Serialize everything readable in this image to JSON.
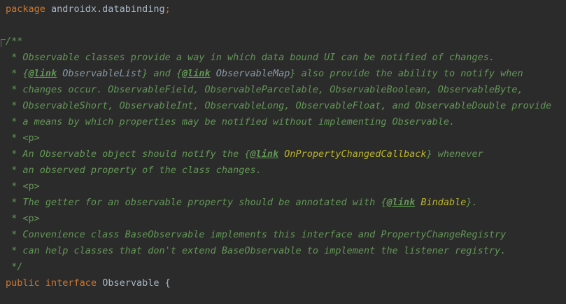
{
  "editor": {
    "language": "java",
    "colors": {
      "background": "#2b2b2b",
      "keyword": "#cc7832",
      "plain": "#a9b7c6",
      "doc_comment": "#629755",
      "doc_reference": "#8a9ba8",
      "annotation_reference": "#bbb529"
    },
    "lines": {
      "l1": {
        "kw": "package",
        "name": " androidx.databinding",
        "semi": ";"
      },
      "l2": {
        "text": "/**"
      },
      "l3": {
        "text": " * Observable classes provide a way in which data bound UI can be notified of changes."
      },
      "l4": {
        "a": " * {",
        "tag1": "@link",
        "ref1": " ObservableList",
        "b": "} and {",
        "tag2": "@link",
        "ref2": " ObservableMap",
        "c": "} also provide the ability to notify when"
      },
      "l5": {
        "text": " * changes occur. ObservableField, ObservableParcelable, ObservableBoolean, ObservableByte,"
      },
      "l6": {
        "text": " * ObservableShort, ObservableInt, ObservableLong, ObservableFloat, and ObservableDouble provide"
      },
      "l7": {
        "text": " * a means by which properties may be notified without implementing Observable."
      },
      "l8": {
        "star": " * ",
        "p": "<p>"
      },
      "l9": {
        "a": " * An Observable object should notify the {",
        "tag": "@link",
        "ref": " OnPropertyChangedCallback",
        "b": "} whenever"
      },
      "l10": {
        "text": " * an observed property of the class changes."
      },
      "l11": {
        "star": " * ",
        "p": "<p>"
      },
      "l12": {
        "a": " * The getter for an observable property should be annotated with {",
        "tag": "@link",
        "ref": " Bindable",
        "b": "}."
      },
      "l13": {
        "star": " * ",
        "p": "<p>"
      },
      "l14": {
        "text": " * Convenience class BaseObservable implements this interface and PropertyChangeRegistry"
      },
      "l15": {
        "text": " * can help classes that don't extend BaseObservable to implement the listener registry."
      },
      "l16": {
        "text": " */"
      },
      "l17": {
        "kw1": "public",
        "kw2": " interface",
        "name": " Observable {"
      }
    }
  }
}
